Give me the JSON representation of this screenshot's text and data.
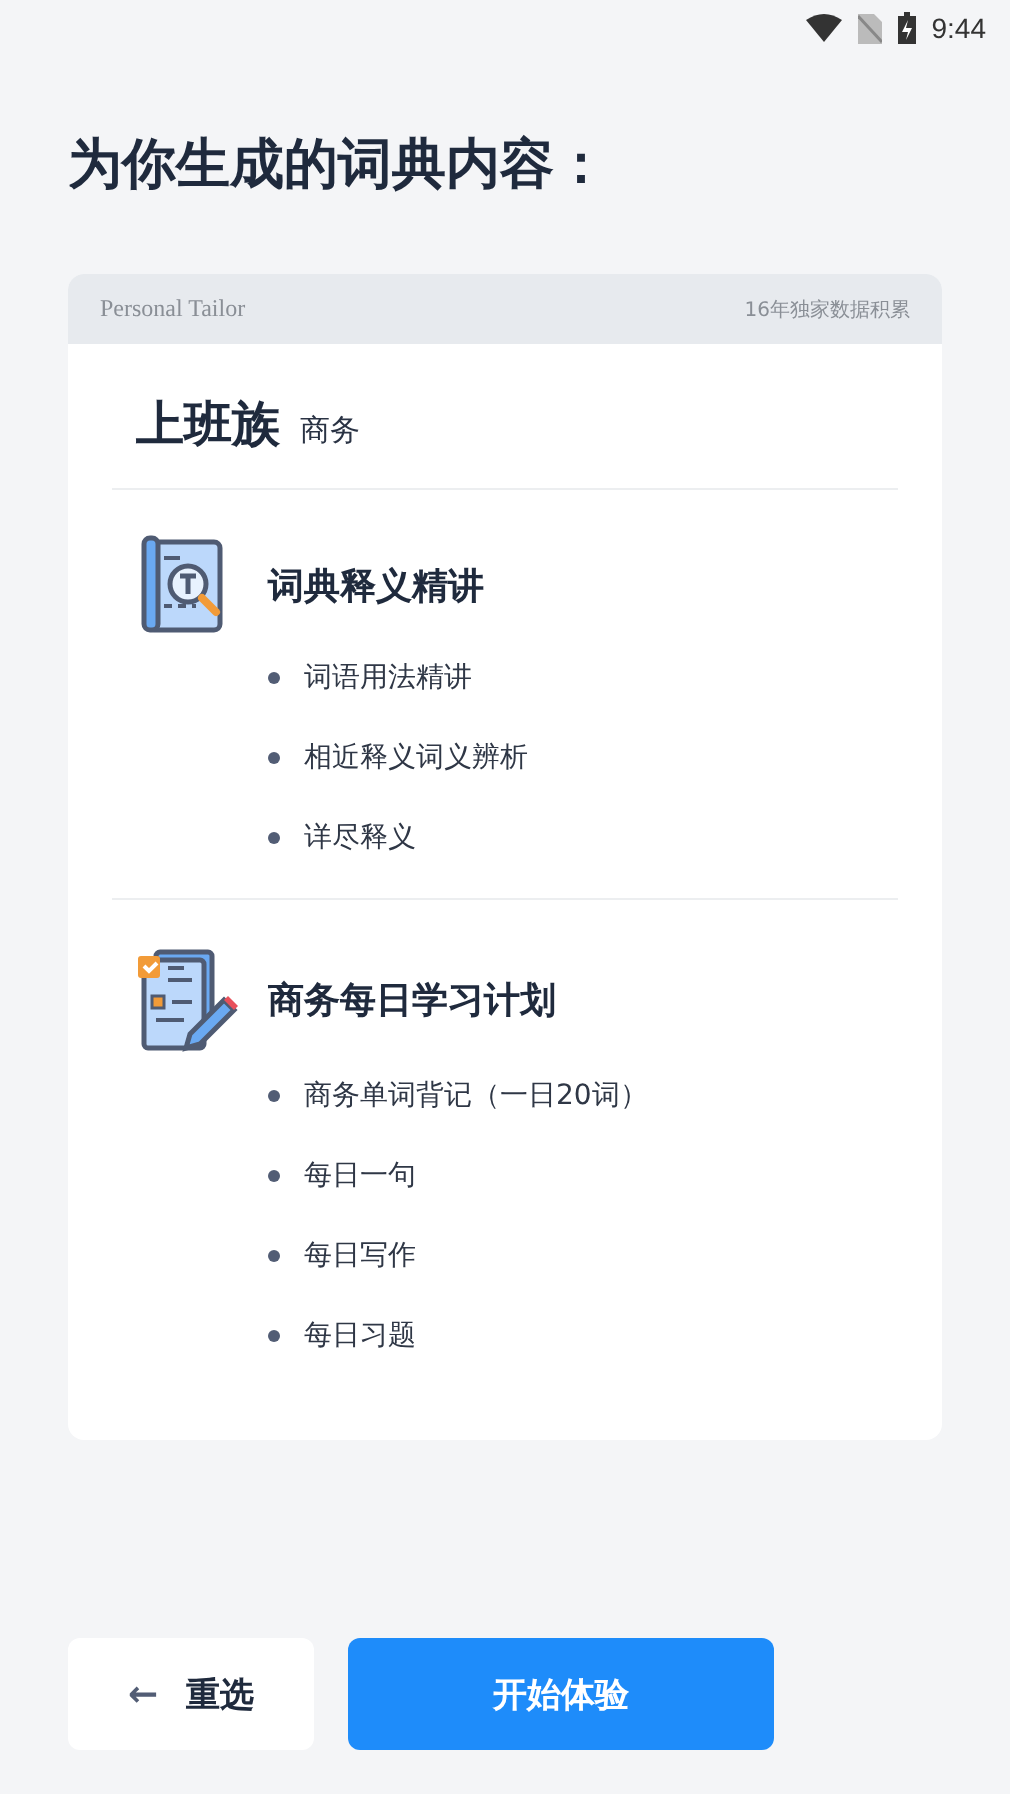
{
  "status_bar": {
    "time": "9:44"
  },
  "title": "为你生成的词典内容：",
  "card": {
    "header_left": "Personal Tailor",
    "header_right": "16年独家数据积累",
    "role": "上班族",
    "role_tag": "商务",
    "sections": [
      {
        "kind": "dictionary",
        "heading": "词典释义精讲",
        "items": [
          "词语用法精讲",
          "相近释义词义辨析",
          "详尽释义"
        ]
      },
      {
        "kind": "plan",
        "heading": "商务每日学习计划",
        "items": [
          "商务单词背记（一日20词）",
          "每日一句",
          "每日写作",
          "每日习题"
        ]
      }
    ]
  },
  "buttons": {
    "back": {
      "arrow": "←",
      "label": "重选"
    },
    "start": "开始体验"
  }
}
